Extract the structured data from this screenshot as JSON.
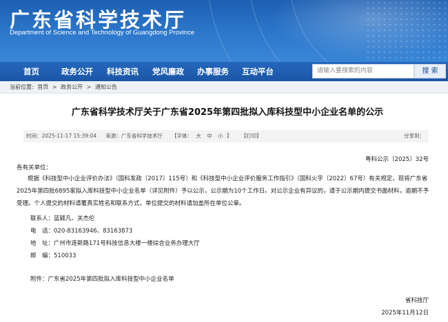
{
  "header": {
    "title": "广东省科学技术厅",
    "subtitle": "Department of Science and Technology of Guangdong Province"
  },
  "nav": {
    "items": [
      "首页",
      "政务公开",
      "科技资讯",
      "党风廉政",
      "办事服务",
      "互动平台"
    ],
    "search_placeholder": "请输入要搜索的内容",
    "search_button": "搜 索"
  },
  "breadcrumb": {
    "prefix": "当前位置:",
    "items": [
      "首页",
      "政务公开",
      "通知公告"
    ],
    "separator": ">"
  },
  "article": {
    "title": "广东省科学技术厅关于广东省2025年第四批拟入库科技型中小企业名单的公示",
    "meta": {
      "time": "时间：2025-11-17 15:39:04",
      "source": "来源：广东省科学技术厅",
      "font_label": "【字体：",
      "font_sizes": [
        "大",
        "中",
        "小"
      ],
      "font_close": "】",
      "print": "【打印】",
      "share": "分享到："
    },
    "doc_number": "粤科公示〔2025〕32号",
    "salutation": "各有关单位：",
    "body": "根据《科技型中小企业评价办法》（国科发政〔2017〕115号）和《科技型中小企业评价服务工作指引》（国科火字〔2022〕67号）有关规定，现将广东省2025年第四批6895家拟入库科技型中小企业名单（详见附件）予以公示，公示期为10个工作日。对公示企业有异议的，请于公示期内提交书面材料，逾期不予受理。个人提交的材料请署真实姓名和联系方式，单位提交的材料请加盖所在单位公章。",
    "contacts": {
      "contact_label": "联系人：",
      "contact_value": "蓝颖凡、关杰伦",
      "phone_label": "电　话：",
      "phone_value": "020-83163946、83163873",
      "address_label": "地　址：",
      "address_value": "广州市连新路171号科技信息大楼一楼综合业务办理大厅",
      "postcode_label": "邮　编：",
      "postcode_value": "510033"
    },
    "attachment": "附件：广东省2025年第四批拟入库科技型中小企业名单",
    "signature": "省科技厅",
    "date": "2025年11月12日"
  }
}
